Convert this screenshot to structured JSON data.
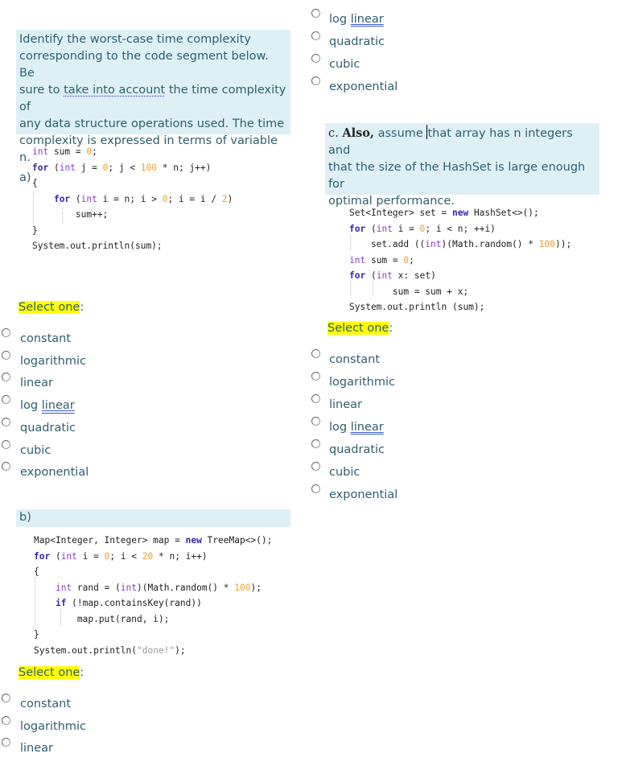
{
  "question_intro": {
    "line1": "Identify the worst-case time complexity",
    "line2": "corresponding to the code segment below.  Be",
    "line3_pre": "sure to ",
    "line3_underlined": "take into account",
    "line3_post": " the time complexity of",
    "line4": "any data structure operations used.  The time",
    "line5": "complexity is expressed in terms of variable n."
  },
  "part_a": {
    "label": "a)",
    "code": [
      [
        {
          "t": "int",
          "c": "ty"
        },
        {
          "t": " sum = "
        },
        {
          "t": "0",
          "c": "num"
        },
        {
          "t": ";"
        }
      ],
      [
        {
          "t": "for",
          "c": "kw"
        },
        {
          "t": " ("
        },
        {
          "t": "int",
          "c": "ty"
        },
        {
          "t": " j = "
        },
        {
          "t": "0",
          "c": "num"
        },
        {
          "t": "; j < "
        },
        {
          "t": "100",
          "c": "num"
        },
        {
          "t": " * n; j++)"
        }
      ],
      [
        {
          "t": "{"
        }
      ],
      [
        {
          "t": "    "
        },
        {
          "t": "for",
          "c": "kw"
        },
        {
          "t": " ("
        },
        {
          "t": "int",
          "c": "ty"
        },
        {
          "t": " i = n; i > "
        },
        {
          "t": "0",
          "c": "num"
        },
        {
          "t": "; i = i / "
        },
        {
          "t": "2",
          "c": "num"
        },
        {
          "t": ")"
        }
      ],
      [
        {
          "t": "        sum++;"
        }
      ],
      [
        {
          "t": "}"
        }
      ],
      [
        {
          "t": "System.out.println(sum);"
        }
      ]
    ],
    "select_label": "Select one",
    "select_colon": ":",
    "options": [
      "constant",
      "logarithmic",
      "linear",
      "log linear",
      "quadratic",
      "cubic",
      "exponential"
    ]
  },
  "part_b": {
    "label": "b)",
    "code": [
      [
        {
          "t": "Map<Integer, Integer> map = "
        },
        {
          "t": "new",
          "c": "kw"
        },
        {
          "t": " TreeMap<>();"
        }
      ],
      [
        {
          "t": "for",
          "c": "kw"
        },
        {
          "t": " ("
        },
        {
          "t": "int",
          "c": "ty"
        },
        {
          "t": " i = "
        },
        {
          "t": "0",
          "c": "num"
        },
        {
          "t": "; i < "
        },
        {
          "t": "20",
          "c": "num"
        },
        {
          "t": " * n; i++)"
        }
      ],
      [
        {
          "t": "{"
        }
      ],
      [
        {
          "t": "    "
        },
        {
          "t": "int",
          "c": "ty"
        },
        {
          "t": " rand = ("
        },
        {
          "t": "int",
          "c": "ty"
        },
        {
          "t": ")(Math.random() * "
        },
        {
          "t": "100",
          "c": "num"
        },
        {
          "t": ");"
        }
      ],
      [
        {
          "t": "    "
        },
        {
          "t": "if",
          "c": "kw"
        },
        {
          "t": " (!map.containsKey(rand))"
        }
      ],
      [
        {
          "t": "        map.put(rand, i);"
        }
      ],
      [
        {
          "t": "}"
        }
      ],
      [
        {
          "t": "System.out.println("
        },
        {
          "t": "\"done!\"",
          "c": "str"
        },
        {
          "t": ");"
        }
      ]
    ],
    "select_label": "Select one",
    "select_colon": ":",
    "options": [
      "constant",
      "logarithmic",
      "linear"
    ]
  },
  "part_b_continued": {
    "options": [
      "log linear",
      "quadratic",
      "cubic",
      "exponential"
    ]
  },
  "part_c": {
    "prefix": "c.  ",
    "also": "Also,",
    "line1_a": " assume ",
    "line1_b": "that array has n integers and",
    "line2": "that the size of the HashSet is large enough for",
    "line3": "optimal performance.",
    "code": [
      [
        {
          "t": "Set<Integer> set = "
        },
        {
          "t": "new",
          "c": "kw"
        },
        {
          "t": " HashSet<>();"
        }
      ],
      [
        {
          "t": "for",
          "c": "kw"
        },
        {
          "t": " ("
        },
        {
          "t": "int",
          "c": "ty"
        },
        {
          "t": " i = "
        },
        {
          "t": "0",
          "c": "num"
        },
        {
          "t": "; i < n; ++i)"
        }
      ],
      [
        {
          "t": "    set.add (("
        },
        {
          "t": "int",
          "c": "ty"
        },
        {
          "t": ")(Math.random() * "
        },
        {
          "t": "100",
          "c": "num"
        },
        {
          "t": "));"
        }
      ],
      [
        {
          "t": "int",
          "c": "ty"
        },
        {
          "t": " sum = "
        },
        {
          "t": "0",
          "c": "num"
        },
        {
          "t": ";"
        }
      ],
      [
        {
          "t": "for",
          "c": "kw"
        },
        {
          "t": " ("
        },
        {
          "t": "int",
          "c": "ty"
        },
        {
          "t": " x: set)"
        }
      ],
      [
        {
          "t": "        sum = sum + x;"
        }
      ],
      [
        {
          "t": "System.out.println (sum);"
        }
      ]
    ],
    "select_label": "Select one",
    "select_colon": ":",
    "options": [
      "constant",
      "logarithmic",
      "linear",
      "log linear",
      "quadratic",
      "cubic",
      "exponential"
    ]
  }
}
